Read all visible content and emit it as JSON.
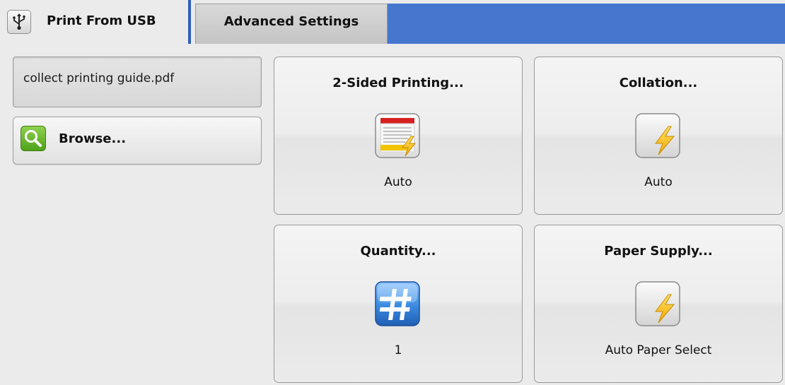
{
  "tabs": {
    "active": {
      "label": "Print From USB",
      "icon": "usb-icon"
    },
    "inactive": {
      "label": "Advanced Settings"
    }
  },
  "file": {
    "name": "collect printing guide.pdf"
  },
  "browse": {
    "label": "Browse...",
    "icon": "magnifier-icon"
  },
  "settings": {
    "duplex": {
      "title": "2-Sided Printing...",
      "value": "Auto",
      "icon": "two-sided-icon"
    },
    "collate": {
      "title": "Collation...",
      "value": "Auto",
      "icon": "auto-lightning-icon"
    },
    "quantity": {
      "title": "Quantity...",
      "value": "1",
      "icon": "hash-icon"
    },
    "paper": {
      "title": "Paper Supply...",
      "value": "Auto Paper Select",
      "icon": "auto-lightning-icon"
    }
  },
  "colors": {
    "tab_bar_blue": "#4677cf",
    "background": "#ebebeb",
    "lightning": "#f2c300",
    "hash_blue": "#2f7fd6",
    "browse_green": "#5aae24"
  }
}
